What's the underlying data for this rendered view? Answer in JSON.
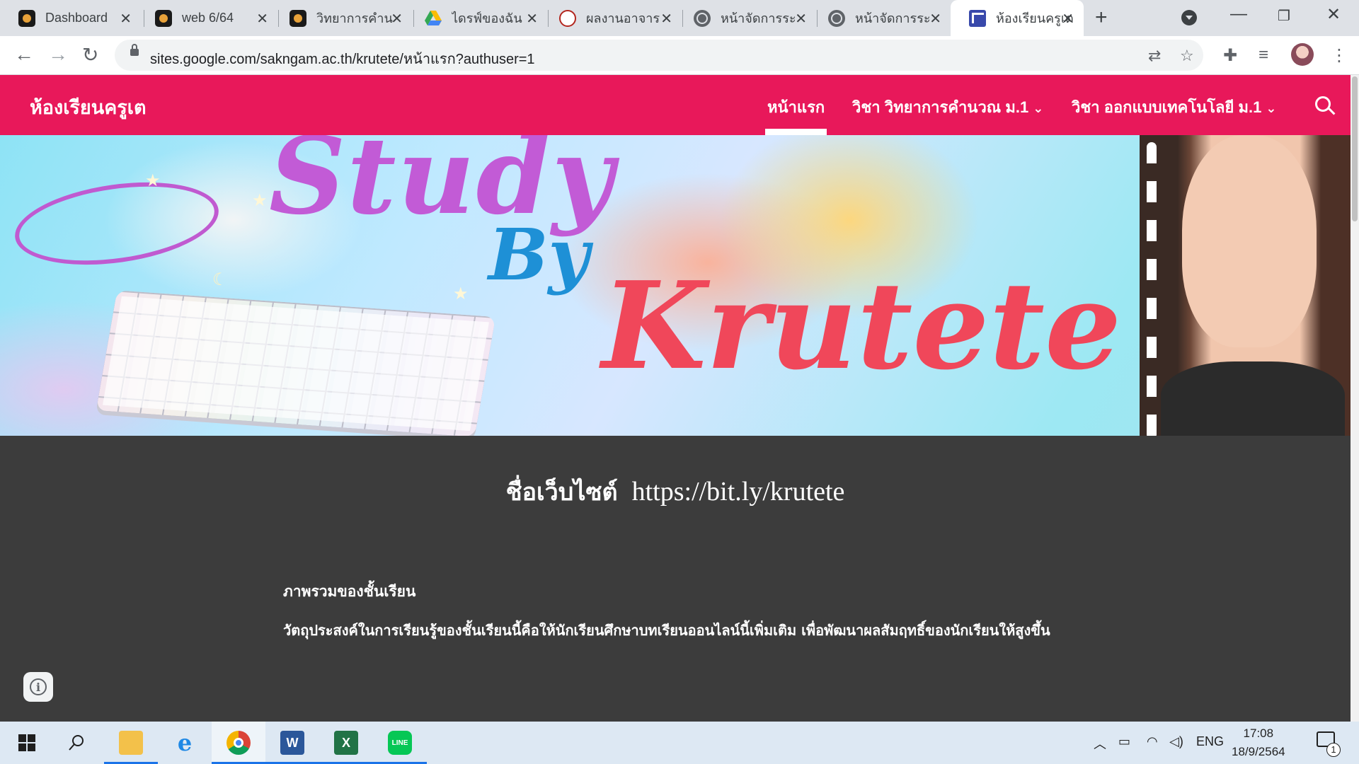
{
  "browser": {
    "tabs": [
      {
        "label": "Dashboard",
        "icon": "dark-app-icon"
      },
      {
        "label": "web 6/64",
        "icon": "dark-app-icon"
      },
      {
        "label": "วิทยาการคำน",
        "icon": "dark-app-icon"
      },
      {
        "label": "ไดรฟ์ของฉัน",
        "icon": "google-drive-icon"
      },
      {
        "label": "ผลงานอาจาร",
        "icon": "certificate-icon"
      },
      {
        "label": "หน้าจัดการระ",
        "icon": "globe-icon"
      },
      {
        "label": "หน้าจัดการระ",
        "icon": "globe-icon"
      },
      {
        "label": "ห้องเรียนครูเต",
        "icon": "google-sites-icon"
      }
    ],
    "active_tab_index": 7,
    "url": "sites.google.com/sakngam.ac.th/krutete/หน้าแรก?authuser=1"
  },
  "site": {
    "title": "ห้องเรียนครูเต",
    "nav": [
      {
        "label": "หน้าแรก",
        "active": true,
        "has_dropdown": false
      },
      {
        "label": "วิชา วิทยาการคำนวณ ม.1",
        "active": false,
        "has_dropdown": true
      },
      {
        "label": "วิชา ออกแบบเทคโนโลยี ม.1",
        "active": false,
        "has_dropdown": true
      }
    ],
    "header_color": "#e8185a"
  },
  "banner": {
    "line1": "Study",
    "line2": "By",
    "line3": "Krutete"
  },
  "content": {
    "headline_thai": "ชื่อเว็บไซต์",
    "headline_link": "https://bit.ly/krutete",
    "section_title": "ภาพรวมของชั้นเรียน",
    "section_body": "วัตถุประสงค์ในการเรียนรู้ของชั้นเรียนนี้คือให้นักเรียนศึกษาบทเรียนออนไลน์นี้เพิ่มเติม เพื่อพัฒนาผลสัมฤทธิ์ของนักเรียนให้สูงขึ้น",
    "background_color": "#3c3c3c"
  },
  "taskbar": {
    "apps": [
      "start",
      "search",
      "file-explorer",
      "internet-explorer",
      "chrome",
      "word",
      "excel",
      "line"
    ],
    "language": "ENG",
    "time": "17:08",
    "date": "18/9/2564",
    "notification_count": "1"
  }
}
